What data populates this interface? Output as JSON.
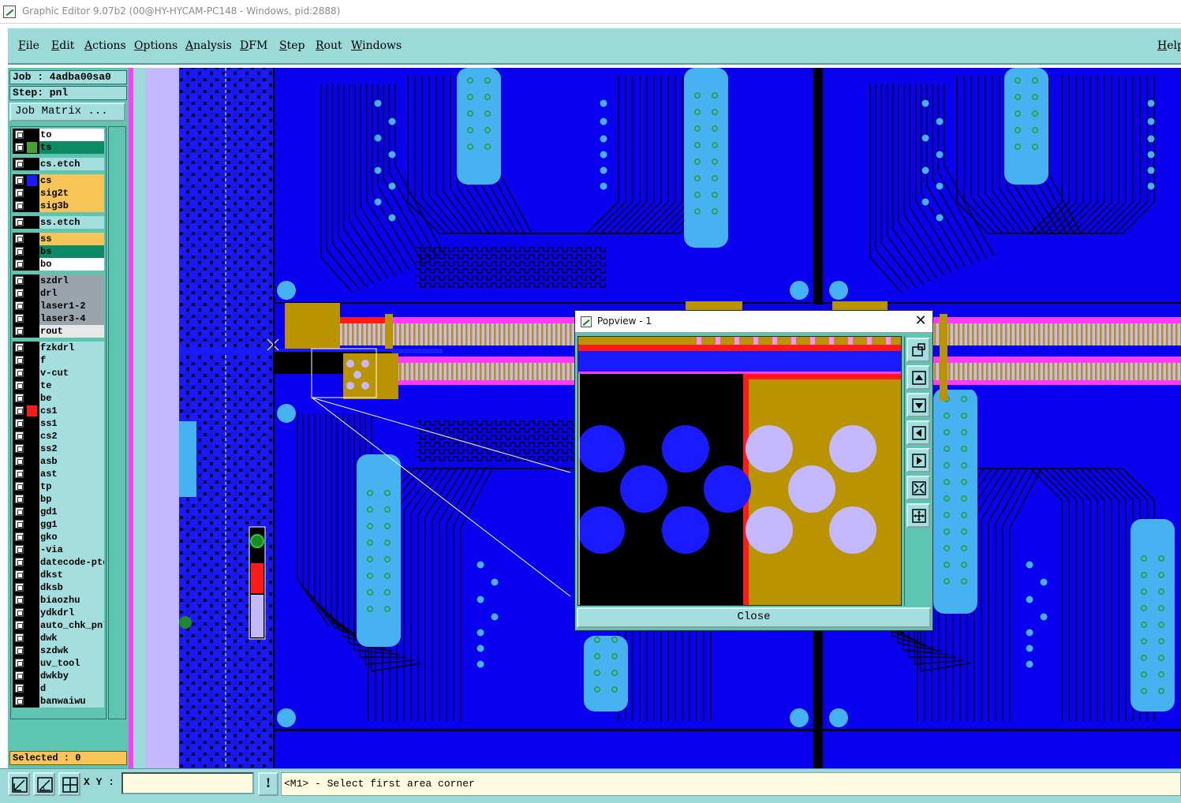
{
  "window": {
    "title": "Graphic Editor 9.07b2 (00@HY-HYCAM-PC148 - Windows, pid:2888)"
  },
  "menu": {
    "items": [
      "File",
      "Edit",
      "Actions",
      "Options",
      "Analysis",
      "DFM",
      "Step",
      "Rout",
      "Windows"
    ],
    "help": "Help"
  },
  "job": {
    "job_label": "Job : 4adba00sa0",
    "step_label": "Step: pnl",
    "matrix_button": "Job Matrix ..."
  },
  "layers": [
    {
      "name": "to",
      "bg": "#ffffff",
      "sw": "#000000",
      "group": 0
    },
    {
      "name": "ts",
      "bg": "#0c8a66",
      "sw": "#4aa02c",
      "group": 0
    },
    {
      "name": "cs.etch",
      "bg": "#a4dede",
      "sw": "#000000",
      "group": 1
    },
    {
      "name": "cs",
      "bg": "#f7c458",
      "sw": "#1a1aff",
      "group": 2
    },
    {
      "name": "sig2t",
      "bg": "#f7c458",
      "sw": "#000000",
      "group": 2
    },
    {
      "name": "sig3b",
      "bg": "#f7c458",
      "sw": "#000000",
      "group": 2
    },
    {
      "name": "ss.etch",
      "bg": "#a4dede",
      "sw": "#000000",
      "group": 3
    },
    {
      "name": "ss",
      "bg": "#f7c458",
      "sw": "#000000",
      "group": 4
    },
    {
      "name": "bs",
      "bg": "#0c8a66",
      "sw": "#000000",
      "group": 4
    },
    {
      "name": "bo",
      "bg": "#ffffff",
      "sw": "#000000",
      "group": 4
    },
    {
      "name": "szdrl",
      "bg": "#9aa4ac",
      "sw": "#000000",
      "group": 5
    },
    {
      "name": "drl",
      "bg": "#9aa4ac",
      "sw": "#000000",
      "group": 5
    },
    {
      "name": "laser1-2",
      "bg": "#9aa4ac",
      "sw": "#000000",
      "group": 5
    },
    {
      "name": "laser3-4",
      "bg": "#9aa4ac",
      "sw": "#000000",
      "group": 5
    },
    {
      "name": "rout",
      "bg": "#e8e8e8",
      "sw": "#000000",
      "group": 5
    },
    {
      "name": "fzkdrl",
      "bg": "#a4dede",
      "sw": "#000000",
      "group": 6
    },
    {
      "name": "f",
      "bg": "#a4dede",
      "sw": "#000000",
      "group": 6
    },
    {
      "name": "v-cut",
      "bg": "#a4dede",
      "sw": "#000000",
      "group": 6
    },
    {
      "name": "te",
      "bg": "#a4dede",
      "sw": "#000000",
      "group": 6
    },
    {
      "name": "be",
      "bg": "#a4dede",
      "sw": "#000000",
      "group": 6
    },
    {
      "name": "cs1",
      "bg": "#a4dede",
      "sw": "#ff1a1a",
      "group": 6
    },
    {
      "name": "ss1",
      "bg": "#a4dede",
      "sw": "#000000",
      "group": 6
    },
    {
      "name": "cs2",
      "bg": "#a4dede",
      "sw": "#000000",
      "group": 6
    },
    {
      "name": "ss2",
      "bg": "#a4dede",
      "sw": "#000000",
      "group": 6
    },
    {
      "name": "asb",
      "bg": "#a4dede",
      "sw": "#000000",
      "group": 6
    },
    {
      "name": "ast",
      "bg": "#a4dede",
      "sw": "#000000",
      "group": 6
    },
    {
      "name": "tp",
      "bg": "#a4dede",
      "sw": "#000000",
      "group": 6
    },
    {
      "name": "bp",
      "bg": "#a4dede",
      "sw": "#000000",
      "group": 6
    },
    {
      "name": "gd1",
      "bg": "#a4dede",
      "sw": "#000000",
      "group": 6
    },
    {
      "name": "gg1",
      "bg": "#a4dede",
      "sw": "#000000",
      "group": 6
    },
    {
      "name": "gko",
      "bg": "#a4dede",
      "sw": "#000000",
      "group": 6
    },
    {
      "name": "-via",
      "bg": "#a4dede",
      "sw": "#000000",
      "group": 6
    },
    {
      "name": "datecode-pte",
      "bg": "#a4dede",
      "sw": "#000000",
      "group": 6
    },
    {
      "name": "dkst",
      "bg": "#a4dede",
      "sw": "#000000",
      "group": 6
    },
    {
      "name": "dksb",
      "bg": "#a4dede",
      "sw": "#000000",
      "group": 6
    },
    {
      "name": "biaozhu",
      "bg": "#a4dede",
      "sw": "#000000",
      "group": 6
    },
    {
      "name": "ydkdrl",
      "bg": "#a4dede",
      "sw": "#000000",
      "group": 6
    },
    {
      "name": "auto_chk_pnl",
      "bg": "#a4dede",
      "sw": "#000000",
      "group": 6
    },
    {
      "name": "dwk",
      "bg": "#a4dede",
      "sw": "#000000",
      "group": 6
    },
    {
      "name": "szdwk",
      "bg": "#a4dede",
      "sw": "#000000",
      "group": 6
    },
    {
      "name": "uv_tool",
      "bg": "#a4dede",
      "sw": "#000000",
      "group": 6
    },
    {
      "name": "dwkby",
      "bg": "#a4dede",
      "sw": "#000000",
      "group": 6
    },
    {
      "name": "d",
      "bg": "#a4dede",
      "sw": "#000000",
      "group": 6
    },
    {
      "name": "banwaiwu",
      "bg": "#a4dede",
      "sw": "#000000",
      "group": 6
    }
  ],
  "status": {
    "selected": "Selected : 0"
  },
  "popview": {
    "title": "Popview - 1",
    "close_button": "Close"
  },
  "bottom": {
    "xy_label": "X Y :",
    "xy_value": "",
    "info_button": "!",
    "message": "<M1> - Select first area corner"
  },
  "colors": {
    "panel": "#5ec6b0",
    "menubar": "#9cd9d9",
    "board": "#0a00f0",
    "copper": "#ba9400",
    "pad": "#47b2f2",
    "pink": "#ff3cff"
  }
}
